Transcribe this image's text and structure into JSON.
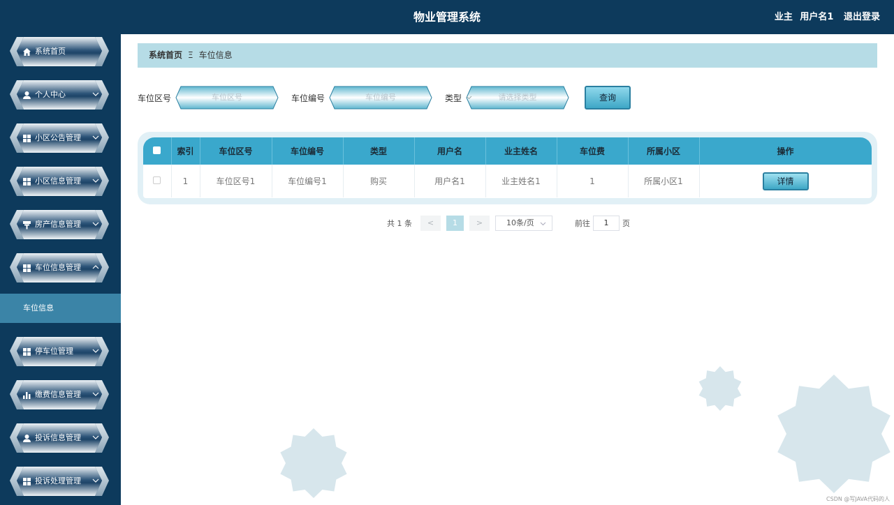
{
  "header": {
    "title": "物业管理系统",
    "role": "业主",
    "username": "用户名1",
    "logout": "退出登录"
  },
  "sidebar": {
    "items": [
      {
        "label": "系统首页",
        "icon": "home-icon"
      },
      {
        "label": "个人中心",
        "icon": "user-icon"
      },
      {
        "label": "小区公告管理",
        "icon": "grid-icon"
      },
      {
        "label": "小区信息管理",
        "icon": "grid-icon"
      },
      {
        "label": "房产信息管理",
        "icon": "signpost-icon"
      },
      {
        "label": "车位信息管理",
        "icon": "grid-icon",
        "expanded": true
      },
      {
        "label": "停车位管理",
        "icon": "grid-icon"
      },
      {
        "label": "缴费信息管理",
        "icon": "bar-chart-icon"
      },
      {
        "label": "投诉信息管理",
        "icon": "user-icon"
      },
      {
        "label": "投诉处理管理",
        "icon": "grid-icon"
      }
    ],
    "active_sub": "车位信息"
  },
  "breadcrumb": {
    "home": "系统首页",
    "separator": "Ξ",
    "current": "车位信息"
  },
  "search": {
    "area_label": "车位区号",
    "area_placeholder": "车位区号",
    "number_label": "车位编号",
    "number_placeholder": "车位编号",
    "type_label": "类型",
    "type_placeholder": "请选择类型",
    "query": "查询"
  },
  "table": {
    "headers": [
      "索引",
      "车位区号",
      "车位编号",
      "类型",
      "用户名",
      "业主姓名",
      "车位费",
      "所属小区",
      "操作"
    ],
    "rows": [
      {
        "index": "1",
        "area": "车位区号1",
        "number": "车位编号1",
        "type": "购买",
        "username": "用户名1",
        "owner": "业主姓名1",
        "fee": "1",
        "community": "所属小区1",
        "action": "详情"
      }
    ]
  },
  "pagination": {
    "total_prefix": "共",
    "total": "1",
    "total_suffix": "条",
    "prev": "<",
    "current": "1",
    "next": ">",
    "page_size": "10条/页",
    "goto_label": "前往",
    "goto_value": "1",
    "goto_suffix": "页"
  },
  "watermark": "CSDN @写JAVA代码的人",
  "colors": {
    "header_bg": "#0d3a5c",
    "accent": "#3aa8cc",
    "breadcrumb_bg": "#b6dce6",
    "active_sub_bg": "#3b84a7"
  }
}
